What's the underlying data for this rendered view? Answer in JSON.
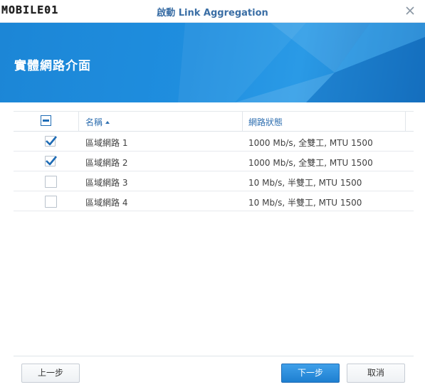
{
  "window": {
    "logo_text": "MOBILE01",
    "title": "啟動 Link Aggregation",
    "close_icon": "close-icon"
  },
  "banner": {
    "title": "實體網路介面",
    "color": "#1f8edf"
  },
  "grid": {
    "columns": {
      "name": "名稱",
      "status": "網路狀態"
    },
    "sort": "name-ascending",
    "header_checkbox": "partial",
    "rows": [
      {
        "name": "區域網路 1",
        "status": "1000 Mb/s, 全雙工, MTU 1500",
        "checked": true
      },
      {
        "name": "區域網路 2",
        "status": "1000 Mb/s, 全雙工, MTU 1500",
        "checked": true
      },
      {
        "name": "區域網路 3",
        "status": "10 Mb/s, 半雙工, MTU 1500",
        "checked": false
      },
      {
        "name": "區域網路 4",
        "status": "10 Mb/s, 半雙工, MTU 1500",
        "checked": false
      }
    ]
  },
  "footer": {
    "prev_label": "上一步",
    "next_label": "下一步",
    "cancel_label": "取消"
  }
}
